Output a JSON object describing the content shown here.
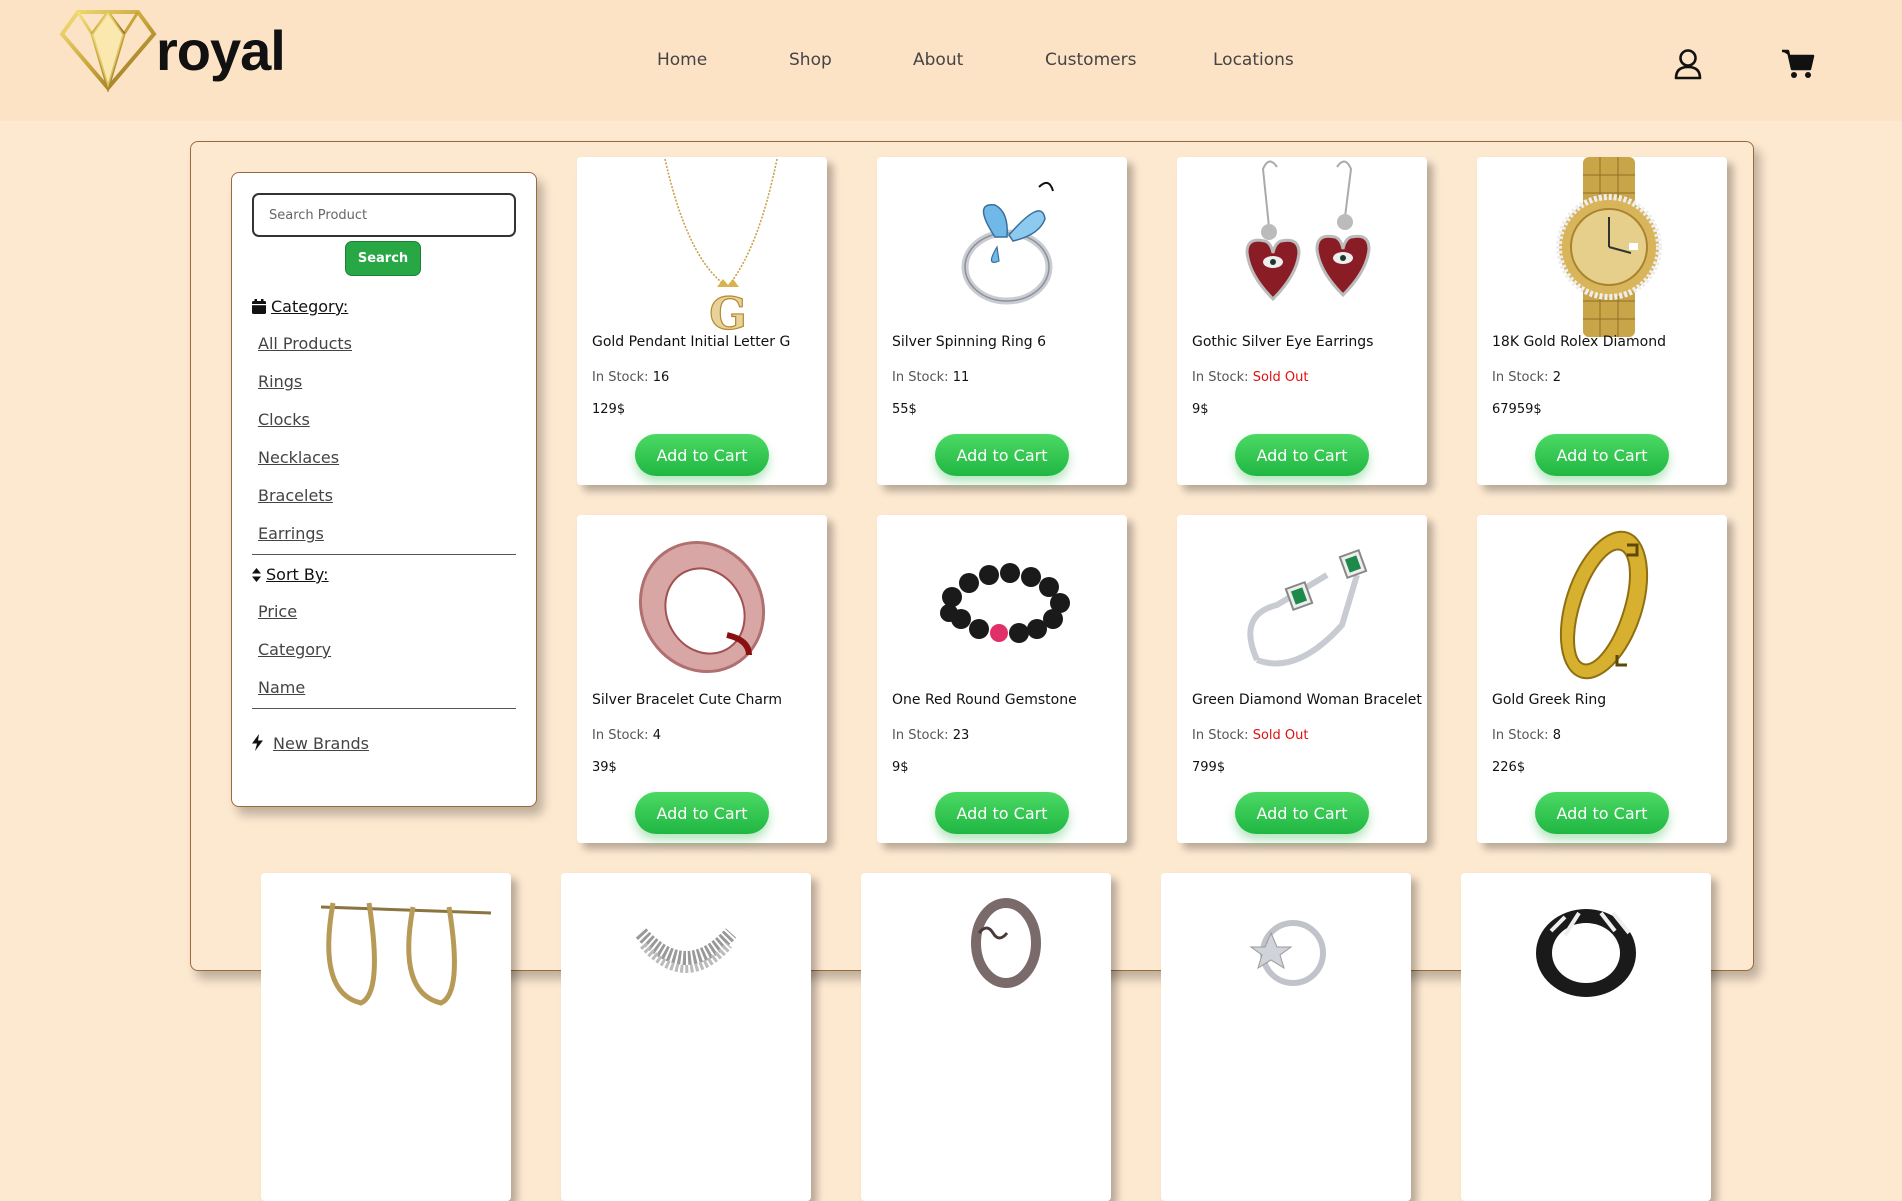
{
  "brand": {
    "name": "royal"
  },
  "nav": {
    "items": [
      {
        "label": "Home"
      },
      {
        "label": "Shop"
      },
      {
        "label": "About"
      },
      {
        "label": "Customers"
      },
      {
        "label": "Locations"
      }
    ]
  },
  "header_icons": [
    "user-icon",
    "cart-icon"
  ],
  "sidebar": {
    "search": {
      "placeholder": "Search Product",
      "value": "",
      "button_label": "Search"
    },
    "category": {
      "heading": "Category:",
      "items": [
        "All Products",
        "Rings",
        "Clocks",
        "Necklaces",
        "Bracelets",
        "Earrings"
      ]
    },
    "sort": {
      "heading": "Sort By:",
      "items": [
        "Price",
        "Category",
        "Name"
      ]
    },
    "new_brands": "New Brands"
  },
  "products": [
    {
      "name": "Gold Pendant Initial Letter G",
      "stock_label": "In Stock: ",
      "stock": "16",
      "sold_out": false,
      "price": "129$",
      "button": "Add to Cart"
    },
    {
      "name": "Silver Spinning Ring 6",
      "stock_label": "In Stock: ",
      "stock": "11",
      "sold_out": false,
      "price": "55$",
      "button": "Add to Cart"
    },
    {
      "name": "Gothic Silver Eye Earrings",
      "stock_label": "In Stock: ",
      "stock": "Sold Out",
      "sold_out": true,
      "price": "9$",
      "button": "Add to Cart"
    },
    {
      "name": "18K Gold Rolex Diamond",
      "stock_label": "In Stock: ",
      "stock": "2",
      "sold_out": false,
      "price": "67959$",
      "button": "Add to Cart"
    },
    {
      "name": "Silver Bracelet Cute Charm",
      "stock_label": "In Stock: ",
      "stock": "4",
      "sold_out": false,
      "price": "39$",
      "button": "Add to Cart"
    },
    {
      "name": "One Red Round Gemstone",
      "stock_label": "In Stock: ",
      "stock": "23",
      "sold_out": false,
      "price": "9$",
      "button": "Add to Cart"
    },
    {
      "name": "Green Diamond Woman Bracelet",
      "stock_label": "In Stock: ",
      "stock": "Sold Out",
      "sold_out": true,
      "price": "799$",
      "button": "Add to Cart"
    },
    {
      "name": "Gold Greek Ring",
      "stock_label": "In Stock: ",
      "stock": "8",
      "sold_out": false,
      "price": "226$",
      "button": "Add to Cart"
    }
  ],
  "colors": {
    "page_bg": "#fde8d0",
    "header_bg": "#fde3c6",
    "accent_green": "#28a745",
    "sold_out": "#e01010",
    "frame_border": "#9a6b3a"
  }
}
